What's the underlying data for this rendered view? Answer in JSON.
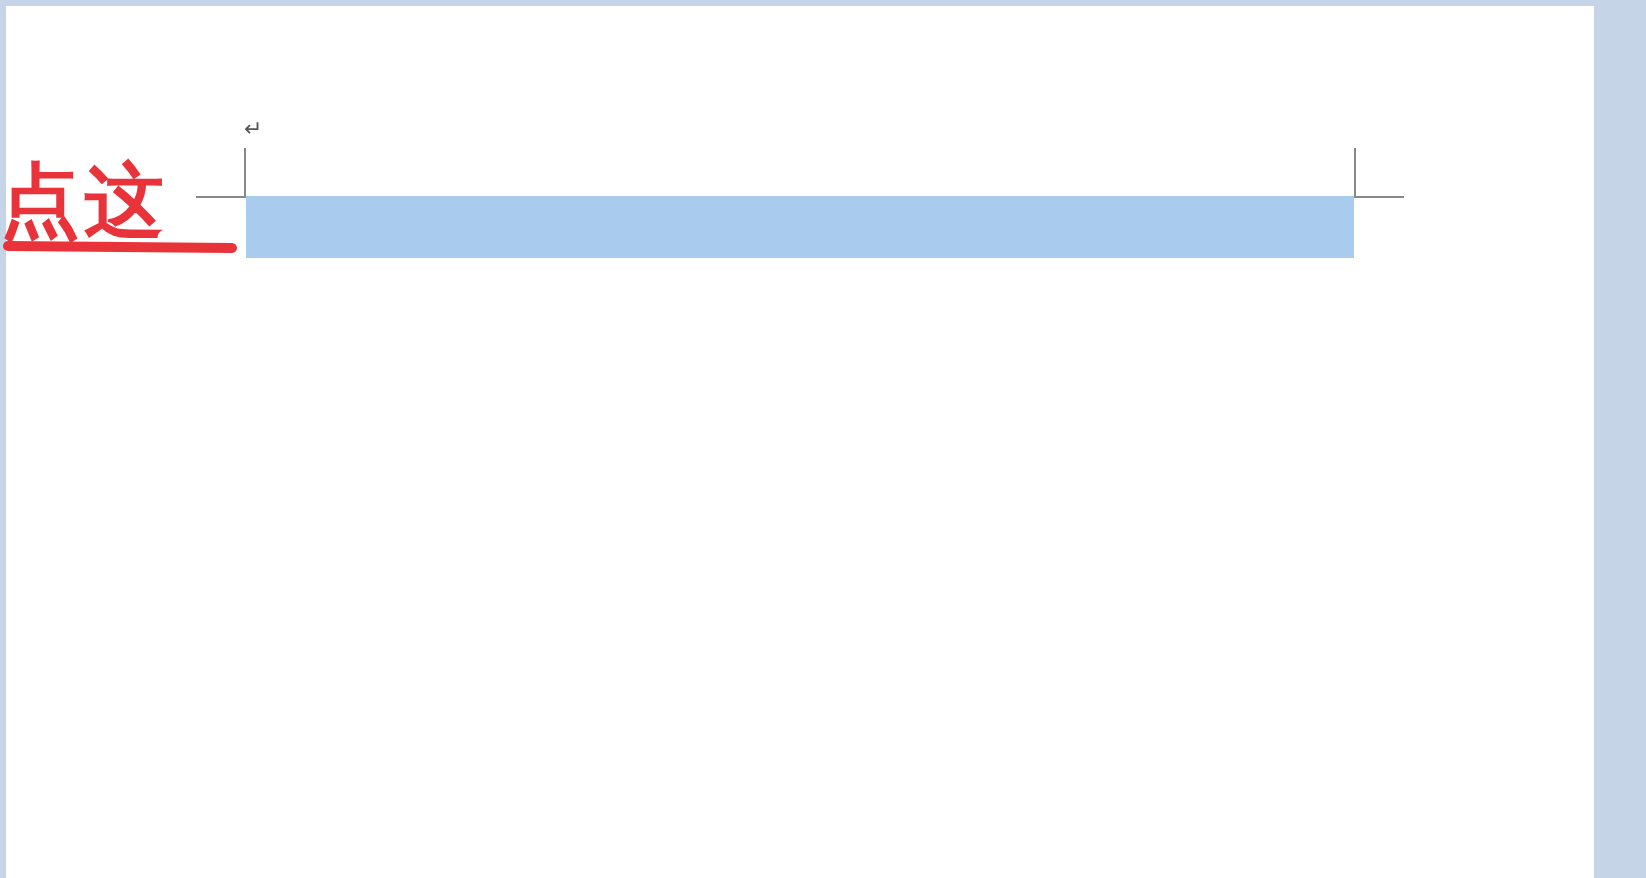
{
  "document": {
    "paragraph_mark": "↵",
    "selected_line": {
      "selected": true
    }
  },
  "annotation": {
    "text": "点这"
  }
}
